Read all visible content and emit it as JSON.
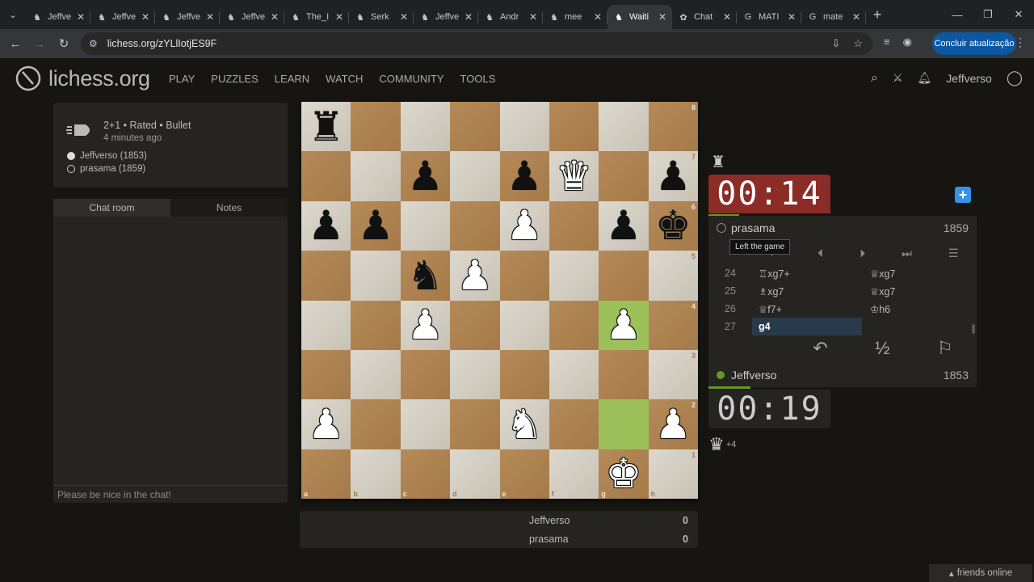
{
  "browser": {
    "tabs": [
      {
        "label": "Jeffve",
        "icon": "lichess-icon"
      },
      {
        "label": "Jeffve",
        "icon": "lichess-icon"
      },
      {
        "label": "Jeffve",
        "icon": "lichess-icon"
      },
      {
        "label": "Jeffve",
        "icon": "lichess-icon"
      },
      {
        "label": "The_I",
        "icon": "lichess-icon"
      },
      {
        "label": "Serk",
        "icon": "lichess-icon"
      },
      {
        "label": "Jeffve",
        "icon": "lichess-icon"
      },
      {
        "label": "Andr",
        "icon": "lichess-icon"
      },
      {
        "label": "mee",
        "icon": "lichess-icon"
      },
      {
        "label": "Waiti",
        "icon": "lichess-icon",
        "active": true
      },
      {
        "label": "Chat",
        "icon": "chatgpt-icon"
      },
      {
        "label": "MATI",
        "icon": "google-icon"
      },
      {
        "label": "mate",
        "icon": "google-icon"
      }
    ],
    "url": "lichess.org/zYLlIotjES9F",
    "update_button": "Concluir atualização"
  },
  "header": {
    "logo_text": "lichess.org",
    "nav": [
      "PLAY",
      "PUZZLES",
      "LEARN",
      "WATCH",
      "COMMUNITY",
      "TOOLS"
    ],
    "username": "Jeffverso"
  },
  "game_info": {
    "type": "2+1 • Rated • Bullet",
    "time_ago": "4 minutes ago",
    "white_player": "Jeffverso (1853)",
    "black_player": "prasama (1859)"
  },
  "chat": {
    "tabs": [
      "Chat room",
      "Notes"
    ],
    "placeholder": "Please be nice in the chat!"
  },
  "board": {
    "files": [
      "a",
      "b",
      "c",
      "d",
      "e",
      "f",
      "g",
      "h"
    ],
    "ranks": [
      "8",
      "7",
      "6",
      "5",
      "4",
      "3",
      "2",
      "1"
    ],
    "pieces": {
      "a8": "br",
      "c7": "bp",
      "e7": "bp",
      "f7": "wq",
      "h7": "bp",
      "a6": "bp",
      "b6": "bp",
      "e6": "wp",
      "g6": "bp",
      "h6": "bk",
      "c5": "bn",
      "d5": "wp",
      "c4": "wp",
      "g4": "wp",
      "a2": "wp",
      "e2": "wn",
      "h2": "wp",
      "g1": "wk"
    },
    "highlight": [
      "g4",
      "g2"
    ]
  },
  "score": {
    "rows": [
      {
        "name": "Jeffverso",
        "value": "0"
      },
      {
        "name": "prasama",
        "value": "0"
      }
    ]
  },
  "opponent": {
    "clock": "00:14",
    "name": "prasama",
    "rating": "1859",
    "tooltip": "Left the game",
    "captured": "♜"
  },
  "player": {
    "clock": "00:19",
    "name": "Jeffverso",
    "rating": "1853",
    "material": "+4"
  },
  "moves": [
    {
      "n": "24",
      "w": "♖xg7+",
      "b": "♕xg7"
    },
    {
      "n": "25",
      "w": "♗xg7",
      "b": "♕xg7"
    },
    {
      "n": "26",
      "w": "♕f7+",
      "b": "♔h6"
    },
    {
      "n": "27",
      "w": "g4",
      "b": ""
    }
  ],
  "actions": {
    "takeback": "↶",
    "draw": "½",
    "resign": "⚐"
  },
  "friends": "friends online"
}
